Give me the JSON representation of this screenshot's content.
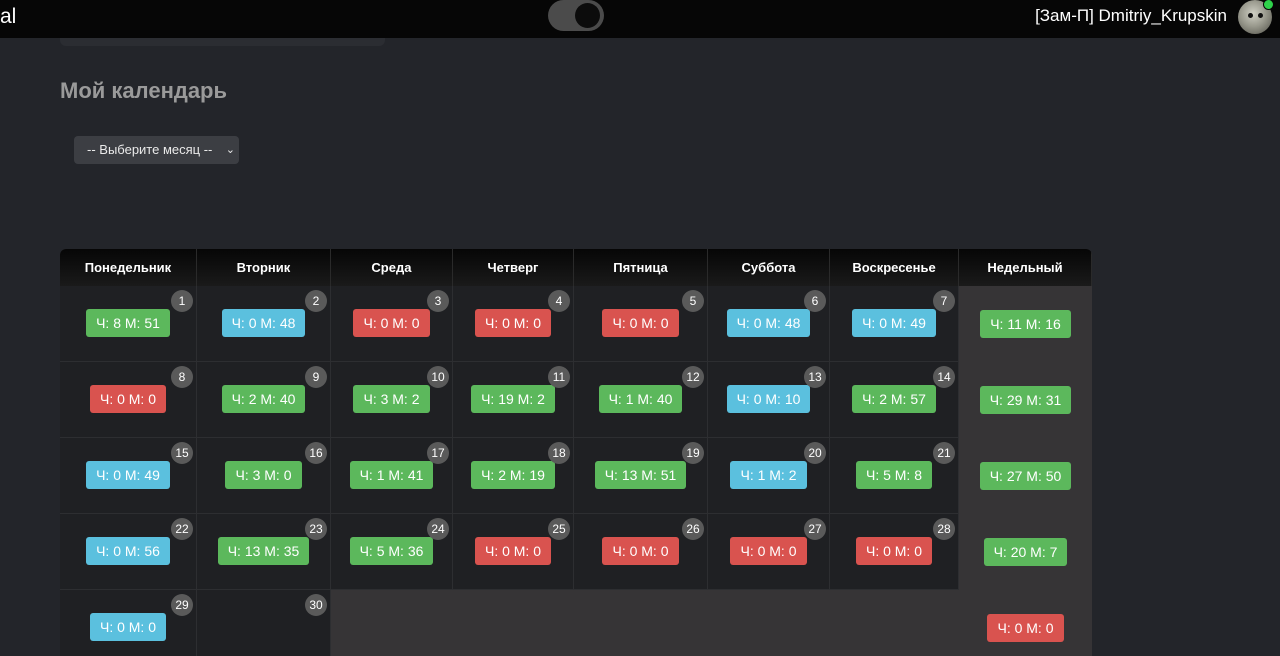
{
  "topbar": {
    "brand": "al",
    "user_name": "[Зам-П] Dmitriy_Krupskin"
  },
  "page": {
    "title": "Мой календарь",
    "month_select_value": "-- Выберите месяц --"
  },
  "colors": {
    "green": "#5cb85c",
    "blue": "#5bc0de",
    "red": "#d9534f"
  },
  "calendar": {
    "headers": [
      "Понедельник",
      "Вторник",
      "Среда",
      "Четверг",
      "Пятница",
      "Суббота",
      "Воскресенье",
      "Недельный"
    ],
    "weeks": [
      {
        "days": [
          {
            "num": "1",
            "text": "Ч: 8 М: 51",
            "color": "green"
          },
          {
            "num": "2",
            "text": "Ч: 0 М: 48",
            "color": "blue"
          },
          {
            "num": "3",
            "text": "Ч: 0 М: 0",
            "color": "red"
          },
          {
            "num": "4",
            "text": "Ч: 0 М: 0",
            "color": "red"
          },
          {
            "num": "5",
            "text": "Ч: 0 М: 0",
            "color": "red"
          },
          {
            "num": "6",
            "text": "Ч: 0 М: 48",
            "color": "blue"
          },
          {
            "num": "7",
            "text": "Ч: 0 М: 49",
            "color": "blue"
          }
        ],
        "weekly": {
          "text": "Ч: 11 М: 16",
          "color": "green"
        }
      },
      {
        "days": [
          {
            "num": "8",
            "text": "Ч: 0 М: 0",
            "color": "red"
          },
          {
            "num": "9",
            "text": "Ч: 2 М: 40",
            "color": "green"
          },
          {
            "num": "10",
            "text": "Ч: 3 М: 2",
            "color": "green"
          },
          {
            "num": "11",
            "text": "Ч: 19 М: 2",
            "color": "green"
          },
          {
            "num": "12",
            "text": "Ч: 1 М: 40",
            "color": "green"
          },
          {
            "num": "13",
            "text": "Ч: 0 М: 10",
            "color": "blue"
          },
          {
            "num": "14",
            "text": "Ч: 2 М: 57",
            "color": "green"
          }
        ],
        "weekly": {
          "text": "Ч: 29 М: 31",
          "color": "green"
        }
      },
      {
        "days": [
          {
            "num": "15",
            "text": "Ч: 0 М: 49",
            "color": "blue"
          },
          {
            "num": "16",
            "text": "Ч: 3 М: 0",
            "color": "green"
          },
          {
            "num": "17",
            "text": "Ч: 1 М: 41",
            "color": "green"
          },
          {
            "num": "18",
            "text": "Ч: 2 М: 19",
            "color": "green"
          },
          {
            "num": "19",
            "text": "Ч: 13 М: 51",
            "color": "green"
          },
          {
            "num": "20",
            "text": "Ч: 1 М: 2",
            "color": "blue"
          },
          {
            "num": "21",
            "text": "Ч: 5 М: 8",
            "color": "green"
          }
        ],
        "weekly": {
          "text": "Ч: 27 М: 50",
          "color": "green"
        }
      },
      {
        "days": [
          {
            "num": "22",
            "text": "Ч: 0 М: 56",
            "color": "blue"
          },
          {
            "num": "23",
            "text": "Ч: 13 М: 35",
            "color": "green"
          },
          {
            "num": "24",
            "text": "Ч: 5 М: 36",
            "color": "green"
          },
          {
            "num": "25",
            "text": "Ч: 0 М: 0",
            "color": "red"
          },
          {
            "num": "26",
            "text": "Ч: 0 М: 0",
            "color": "red"
          },
          {
            "num": "27",
            "text": "Ч: 0 М: 0",
            "color": "red"
          },
          {
            "num": "28",
            "text": "Ч: 0 М: 0",
            "color": "red"
          }
        ],
        "weekly": {
          "text": "Ч: 20 М: 7",
          "color": "green"
        }
      },
      {
        "days": [
          {
            "num": "29",
            "text": "Ч: 0 М: 0",
            "color": "blue"
          },
          {
            "num": "30",
            "text": "",
            "color": ""
          }
        ],
        "weekly": {
          "text": "Ч: 0 М: 0",
          "color": "red"
        }
      }
    ]
  }
}
